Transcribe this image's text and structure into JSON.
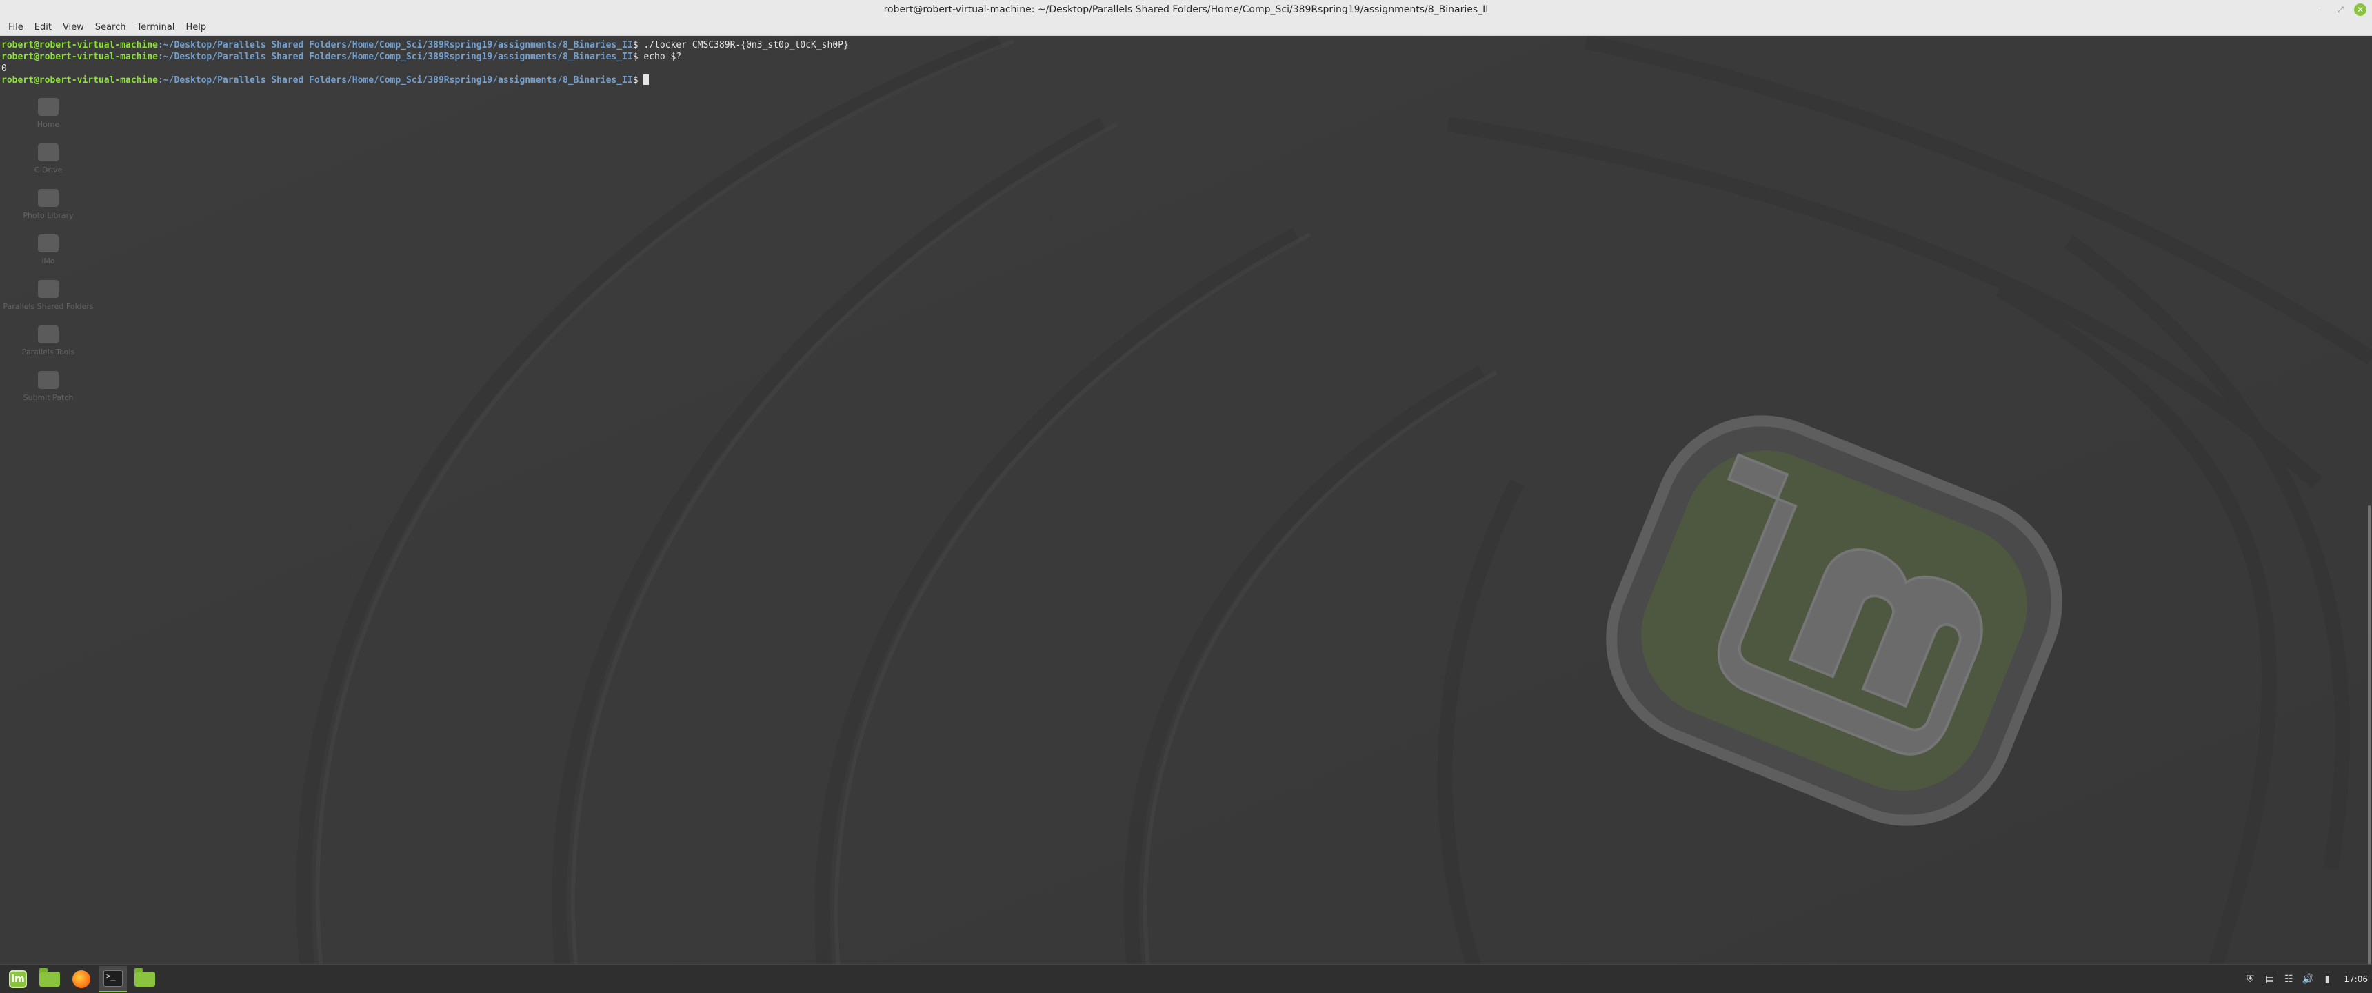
{
  "window": {
    "title": "robert@robert-virtual-machine: ~/Desktop/Parallels Shared Folders/Home/Comp_Sci/389Rspring19/assignments/8_Binaries_II",
    "controls": [
      "minimize-icon",
      "maximize-icon",
      "close-icon"
    ]
  },
  "menubar": {
    "items": [
      "File",
      "Edit",
      "View",
      "Search",
      "Terminal",
      "Help"
    ]
  },
  "terminal": {
    "lines": [
      {
        "user": "robert@robert-virtual-machine",
        "path": ":~/Desktop/Parallels Shared Folders/Home/Comp_Sci/389Rspring19/assignments/8_Binaries_II",
        "symbol": "$ ",
        "command": "./locker CMSC389R-{0n3_st0p_l0cK_sh0P}"
      },
      {
        "user": "robert@robert-virtual-machine",
        "path": ":~/Desktop/Parallels Shared Folders/Home/Comp_Sci/389Rspring19/assignments/8_Binaries_II",
        "symbol": "$ ",
        "command": "echo $?"
      },
      {
        "output": "0"
      },
      {
        "user": "robert@robert-virtual-machine",
        "path": ":~/Desktop/Parallels Shared Folders/Home/Comp_Sci/389Rspring19/assignments/8_Binaries_II",
        "symbol": "$ ",
        "command": ""
      }
    ]
  },
  "desktop": {
    "icons": [
      {
        "label": "Home",
        "icon": "drive-icon"
      },
      {
        "label": "C Drive",
        "icon": "drive-icon"
      },
      {
        "label": "Photo Library",
        "icon": "drive-icon"
      },
      {
        "label": "iMo",
        "icon": "folder-icon"
      },
      {
        "label": "Parallels Shared Folders",
        "icon": "folder-icon"
      },
      {
        "label": "Parallels Tools",
        "icon": "folder-icon"
      },
      {
        "label": "Submit Patch",
        "icon": "file-icon"
      }
    ]
  },
  "taskbar": {
    "launchers": [
      "mint-menu-icon",
      "show-desktop-folder-icon",
      "firefox-icon",
      "terminal-icon",
      "files-icon"
    ],
    "tray": [
      "shield-icon",
      "clipboard-icon",
      "network-icon",
      "volume-icon",
      "battery-icon"
    ],
    "clock": "17:06"
  },
  "colors": {
    "prompt_user": "#8ae234",
    "prompt_path": "#729fcf",
    "mint_green": "#8ac43f",
    "background": "#3b3b3b"
  }
}
